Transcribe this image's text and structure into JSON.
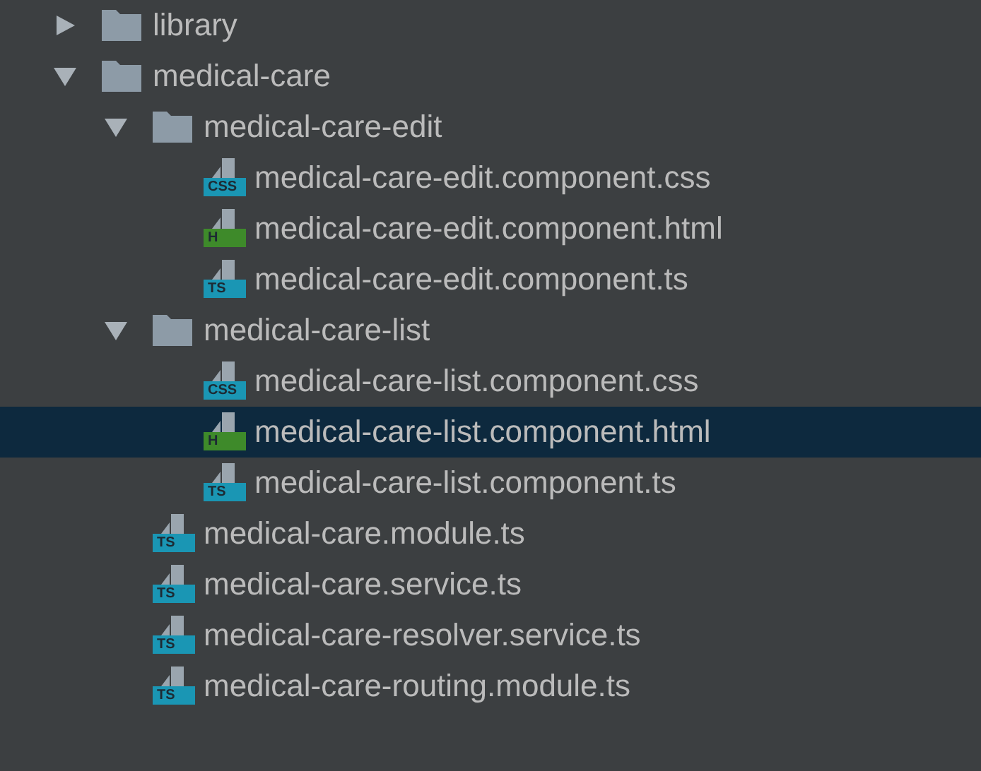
{
  "tree": [
    {
      "label": "library",
      "kind": "folder",
      "expanded": false,
      "selected": false
    },
    {
      "label": "medical-care",
      "kind": "folder",
      "expanded": true,
      "selected": false,
      "children": [
        {
          "label": "medical-care-edit",
          "kind": "folder",
          "expanded": true,
          "selected": false,
          "children": [
            {
              "label": "medical-care-edit.component.css",
              "kind": "css",
              "badge": "CSS",
              "selected": false
            },
            {
              "label": "medical-care-edit.component.html",
              "kind": "html",
              "badge": "H",
              "selected": false
            },
            {
              "label": "medical-care-edit.component.ts",
              "kind": "ts",
              "badge": "TS",
              "selected": false
            }
          ]
        },
        {
          "label": "medical-care-list",
          "kind": "folder",
          "expanded": true,
          "selected": false,
          "children": [
            {
              "label": "medical-care-list.component.css",
              "kind": "css",
              "badge": "CSS",
              "selected": false
            },
            {
              "label": "medical-care-list.component.html",
              "kind": "html",
              "badge": "H",
              "selected": true
            },
            {
              "label": "medical-care-list.component.ts",
              "kind": "ts",
              "badge": "TS",
              "selected": false
            }
          ]
        },
        {
          "label": "medical-care.module.ts",
          "kind": "ts",
          "badge": "TS",
          "selected": false
        },
        {
          "label": "medical-care.service.ts",
          "kind": "ts",
          "badge": "TS",
          "selected": false
        },
        {
          "label": "medical-care-resolver.service.ts",
          "kind": "ts",
          "badge": "TS",
          "selected": false
        },
        {
          "label": "medical-care-routing.module.ts",
          "kind": "ts",
          "badge": "TS",
          "selected": false
        }
      ]
    }
  ]
}
